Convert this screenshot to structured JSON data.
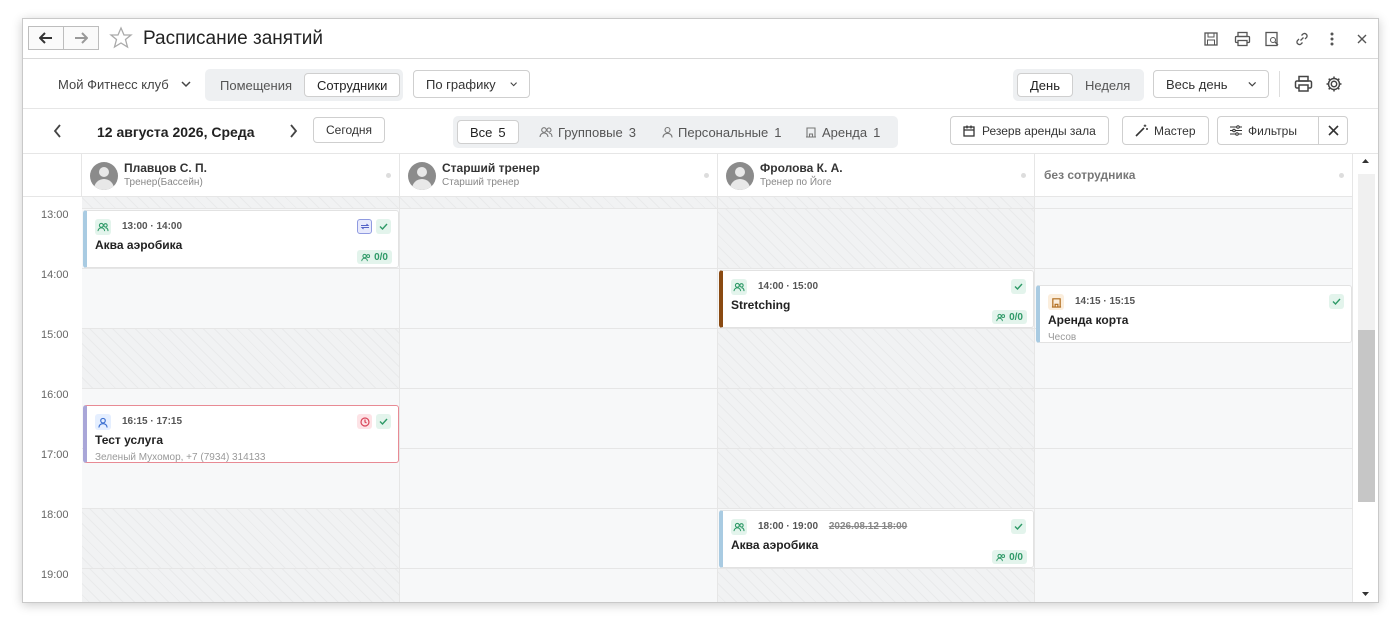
{
  "window": {
    "title": "Расписание занятий"
  },
  "toolbar": {
    "club": "Мой Фитнесс клуб",
    "view_toggle": [
      "Помещения",
      "Сотрудники"
    ],
    "view_active": "Сотрудники",
    "schedule_mode": "По графику",
    "period_toggle": [
      "День",
      "Неделя"
    ],
    "period_active": "День",
    "time_range": "Весь день"
  },
  "nav": {
    "date": "12 августа 2026, Среда",
    "today": "Сегодня",
    "filters": [
      {
        "label": "Все",
        "count": "5"
      },
      {
        "label": "Групповые",
        "count": "3"
      },
      {
        "label": "Персональные",
        "count": "1"
      },
      {
        "label": "Аренда",
        "count": "1"
      }
    ],
    "reserve": "Резерв аренды зала",
    "wizard": "Мастер",
    "filter_btn": "Фильтры"
  },
  "columns": [
    {
      "name": "Плавцов С. П.",
      "role": "Тренер(Бассейн)"
    },
    {
      "name": "Старший тренер",
      "role": "Старший тренер"
    },
    {
      "name": "Фролова К. А.",
      "role": "Тренер по Йоге"
    },
    {
      "name": "без сотрудника",
      "role": ""
    }
  ],
  "hours": [
    "13:00",
    "14:00",
    "15:00",
    "16:00",
    "17:00",
    "18:00",
    "19:00"
  ],
  "events": [
    {
      "time": "13:00 · 14:00",
      "name": "Аква аэробика",
      "count": "0/0"
    },
    {
      "time": "14:00 · 15:00",
      "name": "Stretching",
      "count": "0/0"
    },
    {
      "time": "14:15 · 15:15",
      "name": "Аренда корта",
      "sub": "Чесов"
    },
    {
      "time": "16:15 · 17:15",
      "name": "Тест услуга",
      "sub": "Зеленый Мухомор, +7 (7934) 314133"
    },
    {
      "time": "18:00 · 19:00",
      "old_time": "2026.08.12 18:00",
      "name": "Аква аэробика",
      "count": "0/0"
    }
  ],
  "colors": {
    "accent_green": "#2f9a68",
    "accent_blue": "#a9cbe2",
    "accent_brown": "#8a4a12",
    "alert_red": "#e88a94"
  }
}
